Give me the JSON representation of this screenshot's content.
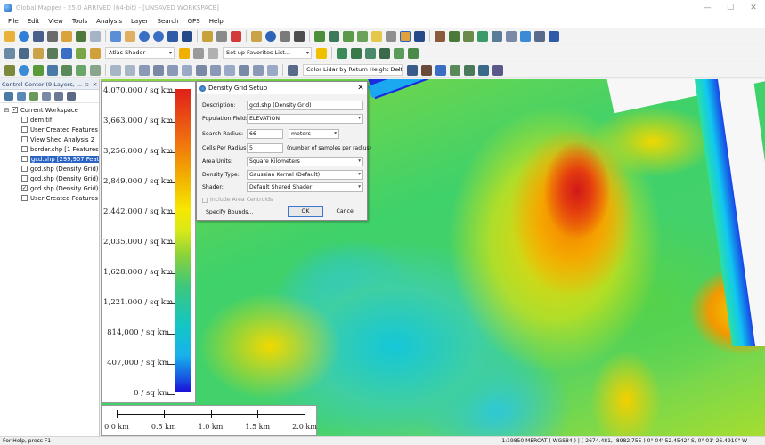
{
  "window": {
    "title": "Global Mapper - 25.0 ARRIVED (64-bit) - [UNSAVED WORKSPACE]",
    "controls": [
      "—",
      "☐",
      "✕"
    ]
  },
  "menu": [
    "File",
    "Edit",
    "View",
    "Tools",
    "Analysis",
    "Layer",
    "Search",
    "GPS",
    "Help"
  ],
  "toolbar": {
    "shader_combo": "Atlas Shader",
    "favorites_combo": "Set up Favorites List...",
    "lidar_combo": "Color Lidar by Return Height Delta"
  },
  "control_center": {
    "title": "Control Center (9 Layers, ...",
    "workspace": "Current Workspace",
    "layers": [
      {
        "label": "dem.tif",
        "checked": false,
        "selected": false
      },
      {
        "label": "User Created Features",
        "checked": false,
        "selected": false
      },
      {
        "label": "View Shed Analysis 2",
        "checked": false,
        "selected": false
      },
      {
        "label": "border.shp [1 Features]",
        "checked": false,
        "selected": false
      },
      {
        "label": "gcd.shp [299,907 Features]",
        "checked": false,
        "selected": true
      },
      {
        "label": "gcd.shp (Density Grid)",
        "checked": false,
        "selected": false
      },
      {
        "label": "gcd.shp (Density Grid)",
        "checked": false,
        "selected": false
      },
      {
        "label": "gcd.shp (Density Grid)",
        "checked": true,
        "selected": false
      },
      {
        "label": "User Created Features",
        "checked": false,
        "selected": false
      }
    ]
  },
  "legend": {
    "labels": [
      "4,070,000 / sq km",
      "3,663,000 / sq km",
      "3,256,000 / sq km",
      "2,849,000 / sq km",
      "2,442,000 / sq km",
      "2,035,000 / sq km",
      "1,628,000 / sq km",
      "1,221,000 / sq km",
      "814,000 / sq km",
      "407,000 / sq km",
      "0 / sq km"
    ],
    "values_per_sq_km": [
      4070000,
      3663000,
      3256000,
      2849000,
      2442000,
      2035000,
      1628000,
      1221000,
      814000,
      407000,
      0
    ]
  },
  "scalebar": {
    "labels": [
      "0.0 km",
      "0.5 km",
      "1.0 km",
      "1.5 km",
      "2.0 km"
    ]
  },
  "dialog": {
    "title": "Density Grid Setup",
    "description_label": "Description:",
    "description_value": "gcd.shp (Density Grid)",
    "population_label": "Population Field:",
    "population_value": "ELEVATION",
    "radius_label": "Search Radius:",
    "radius_value": "66",
    "radius_units": "meters",
    "cells_label": "Cells Per Radius:",
    "cells_value": "5",
    "cells_note": "(number of samples per radius)",
    "area_units_label": "Area Units:",
    "area_units_value": "Square Kilometers",
    "density_type_label": "Density Type:",
    "density_type_value": "Gaussian Kernel (Default)",
    "shader_label": "Shader:",
    "shader_value": "Default Shared Shader",
    "include_centroids": "Include Area Centroids",
    "specify_bounds": "Specify Bounds...",
    "ok": "OK",
    "cancel": "Cancel"
  },
  "status": {
    "help": "For Help, press F1",
    "coords": "1:19850  MERCAT ( WGS84 ) | (-2674.481, -8982.755 )  0° 04' 52.4542\" S, 0° 01' 26.4910\" W"
  },
  "colors": {
    "selection": "#2a64c5",
    "default_button_border": "#3a78d0"
  }
}
